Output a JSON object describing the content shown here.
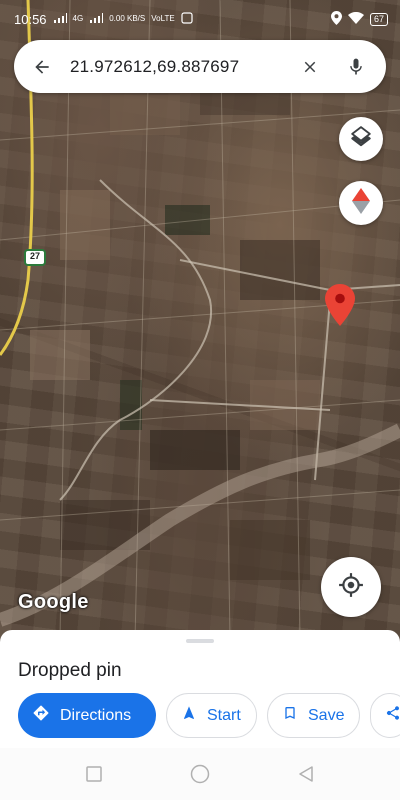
{
  "status_bar": {
    "time": "10:56",
    "signal_text_1": "4G",
    "signal_text_2": "0.00\nKB/S",
    "carrier_text": "VoLTE",
    "battery": "67"
  },
  "search": {
    "query": "21.972612,69.887697",
    "back_icon": "arrow-left-icon",
    "clear_icon": "close-icon",
    "voice_icon": "microphone-icon"
  },
  "map": {
    "road_shield": "27",
    "watermark": "Google",
    "pin_color": "#ea4335"
  },
  "sheet": {
    "title": "Dropped pin",
    "actions": {
      "directions": "Directions",
      "start": "Start",
      "save": "Save"
    }
  },
  "colors": {
    "accent": "#1a73e8",
    "text": "#202124",
    "border": "#dadce0"
  }
}
